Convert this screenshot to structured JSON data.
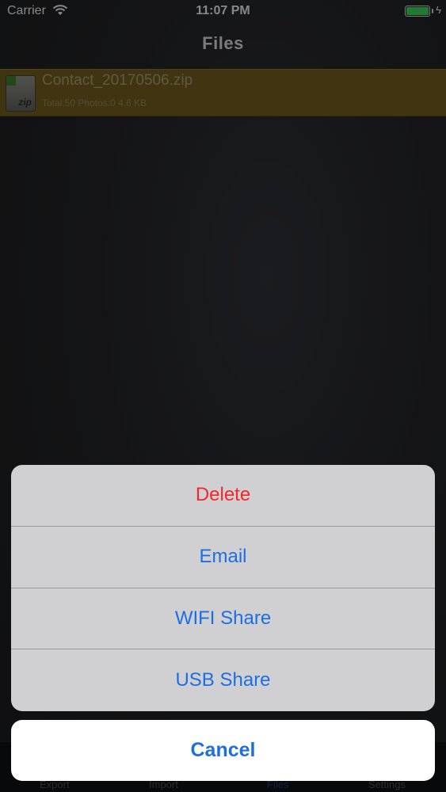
{
  "status_bar": {
    "carrier": "Carrier",
    "time": "11:07 PM",
    "battery_icon": "battery-full-icon",
    "wifi_icon": "wifi-icon"
  },
  "nav": {
    "title": "Files"
  },
  "files": [
    {
      "name": "Contact_20170506.zip",
      "meta": "Total:50 Photos:0   4.6 KB",
      "icon": "zip-file-icon",
      "icon_label": "zip"
    }
  ],
  "tabs": [
    "Export",
    "Import",
    "Files",
    "Settings"
  ],
  "action_sheet": {
    "items": [
      {
        "label": "Delete",
        "style": "destructive"
      },
      {
        "label": "Email",
        "style": "default"
      },
      {
        "label": "WIFI Share",
        "style": "default"
      },
      {
        "label": "USB Share",
        "style": "default"
      }
    ],
    "cancel_label": "Cancel"
  },
  "colors": {
    "action_blue": "#1d6fe0",
    "destructive_red": "#f2282c",
    "selected_row": "#6e5c1c",
    "battery_green": "#3bd15a"
  }
}
